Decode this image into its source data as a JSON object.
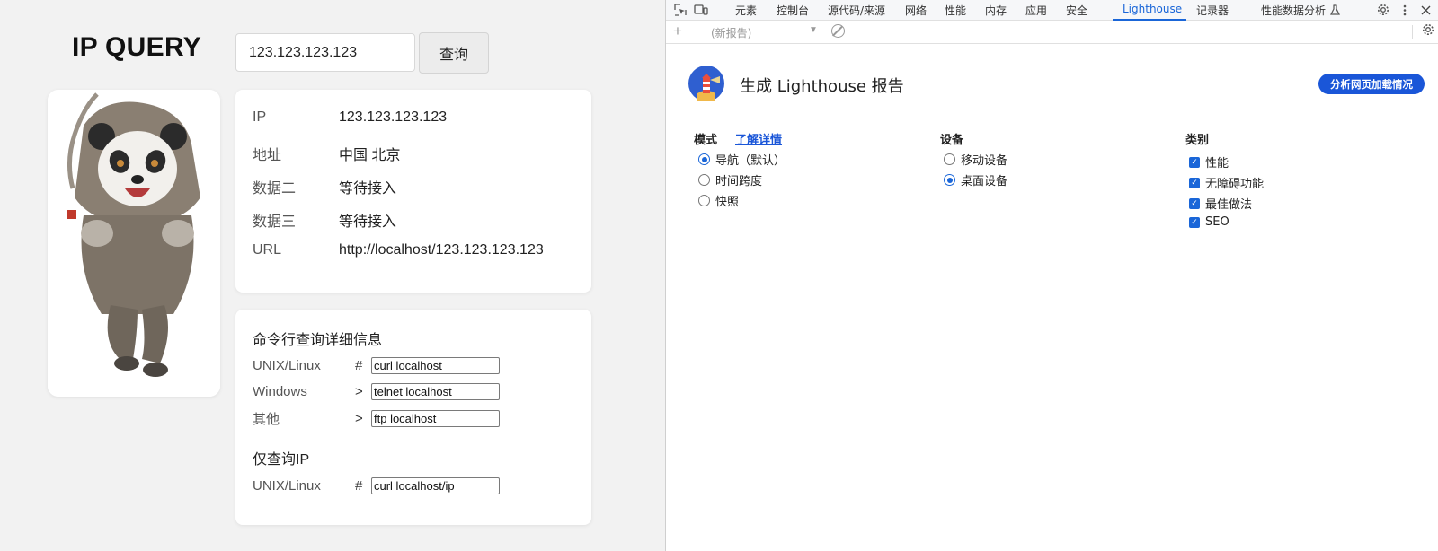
{
  "page": {
    "title": "IP QUERY",
    "search_value": "123.123.123.123",
    "query_button": "查询",
    "info": [
      {
        "key": "IP",
        "value": "123.123.123.123"
      },
      {
        "key": "地址",
        "value": "中国 北京"
      },
      {
        "key": "数据二",
        "value": "等待接入"
      },
      {
        "key": "数据三",
        "value": "等待接入"
      },
      {
        "key": "URL",
        "value": "http://localhost/123.123.123.123"
      }
    ],
    "cmd_title": "命令行查询详细信息",
    "cmd_rows": [
      {
        "os": "UNIX/Linux",
        "prompt": "#",
        "command": "curl localhost"
      },
      {
        "os": "Windows",
        "prompt": ">",
        "command": "telnet localhost"
      },
      {
        "os": "其他",
        "prompt": ">",
        "command": "ftp localhost"
      }
    ],
    "ip_only_title": "仅查询IP",
    "ip_only_row": {
      "os": "UNIX/Linux",
      "prompt": "#",
      "command": "curl localhost/ip"
    }
  },
  "devtools": {
    "tabs": [
      "元素",
      "控制台",
      "源代码/来源",
      "网络",
      "性能",
      "内存",
      "应用",
      "安全",
      "Lighthouse",
      "记录器",
      "性能数据分析"
    ],
    "active_tab": "Lighthouse",
    "new_report": "(新报告)",
    "heading": "生成 Lighthouse 报告",
    "analyze_button": "分析网页加载情况",
    "mode": {
      "title": "模式",
      "learn_more": "了解详情",
      "options": [
        "导航（默认）",
        "时间跨度",
        "快照"
      ],
      "selected": 0
    },
    "device": {
      "title": "设备",
      "options": [
        "移动设备",
        "桌面设备"
      ],
      "selected": 1
    },
    "categories": {
      "title": "类别",
      "options": [
        "性能",
        "无障碍功能",
        "最佳做法",
        "SEO"
      ]
    }
  },
  "colors": {
    "accent": "#1a66d8",
    "button_blue": "#1a56d8"
  }
}
